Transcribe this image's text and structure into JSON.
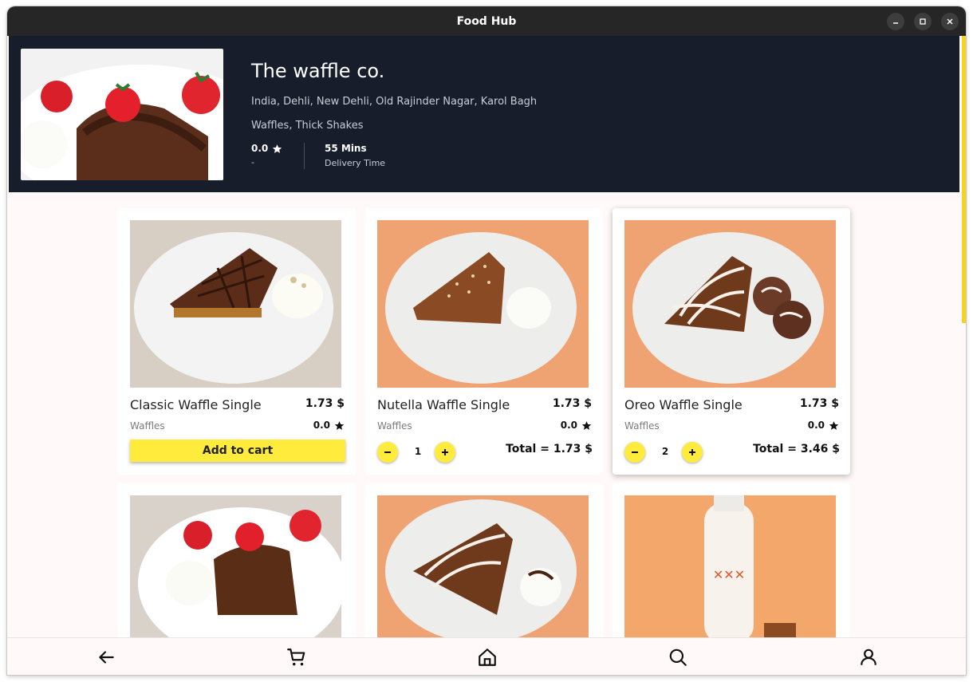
{
  "window": {
    "title": "Food Hub"
  },
  "restaurant": {
    "name": "The waffle co.",
    "address": "India, Dehli, New Dehli, Old Rajinder Nagar, Karol Bagh",
    "cuisines": "Waffles, Thick Shakes",
    "rating": "0.0",
    "rating_sub": "-",
    "delivery_time": "55 Mins",
    "delivery_label": "Delivery Time"
  },
  "items": [
    {
      "name": "Classic Waffle Single",
      "price": "1.73 $",
      "category": "Waffles",
      "rating": "0.0",
      "action": "Add to cart"
    },
    {
      "name": "Nutella Waffle Single",
      "price": "1.73 $",
      "category": "Waffles",
      "rating": "0.0",
      "quantity": "1",
      "total": "Total = 1.73 $"
    },
    {
      "name": "Oreo Waffle Single",
      "price": "1.73 $",
      "category": "Waffles",
      "rating": "0.0",
      "quantity": "2",
      "total": "Total = 3.46 $"
    }
  ],
  "icons": {
    "window": [
      "minimize-icon",
      "maximize-icon",
      "close-icon"
    ],
    "nav": [
      "back-arrow-icon",
      "cart-icon",
      "home-icon",
      "search-icon",
      "user-icon"
    ],
    "rating": "star-icon",
    "quantity": [
      "minus-icon",
      "plus-icon"
    ]
  },
  "colors": {
    "accent": "#ffeb3b",
    "header_bg": "#181d2c",
    "titlebar": "#262626",
    "scrollbar": "#f5d419"
  }
}
